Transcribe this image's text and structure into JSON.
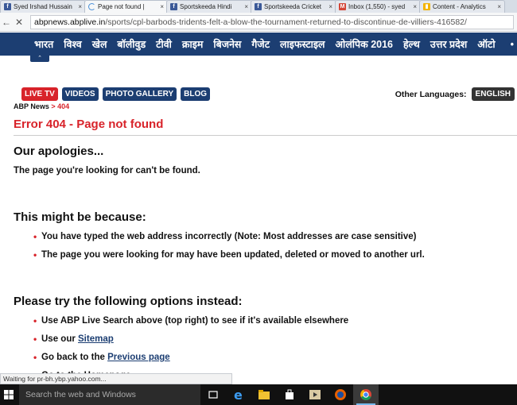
{
  "browser": {
    "tabs": [
      {
        "label": "Syed Irshad Hussain",
        "icon": "facebook-icon",
        "color": "#3b5998"
      },
      {
        "label": "Page not found |",
        "icon": "loading-spinner-icon",
        "color": "#4a90d9"
      },
      {
        "label": "Sportskeeda Hindi",
        "icon": "facebook-icon",
        "color": "#3b5998"
      },
      {
        "label": "Sportskeeda Cricket",
        "icon": "facebook-icon",
        "color": "#3b5998"
      },
      {
        "label": "Inbox (1,550) - syed",
        "icon": "gmail-icon",
        "color": "#d44638"
      },
      {
        "label": "Content - Analytics",
        "icon": "analytics-icon",
        "color": "#f4b400"
      }
    ],
    "url_host": "abpnews.abplive.in",
    "url_path": "/sports/cpl-barbods-tridents-felt-a-blow-the-tournament-returned-to-discontinue-de-villiers-416582/"
  },
  "nav": {
    "items": [
      "भारत",
      "विश्व",
      "खेल",
      "बॉलीवुड",
      "टीवी",
      "क्राइम",
      "बिजनेस",
      "गैजेट",
      "लाइफस्टाइल",
      "ओलंपिक 2016",
      "हेल्थ",
      "उत्तर प्रदेश",
      "ऑटो"
    ],
    "more": "•"
  },
  "buttons": {
    "live": "LIVE TV",
    "videos": "VIDEOS",
    "gallery": "PHOTO GALLERY",
    "blog": "BLOG"
  },
  "languages": {
    "label": "Other Languages:",
    "english": "ENGLISH"
  },
  "breadcrumb": {
    "home": "ABP News",
    "sep": " > ",
    "current": "404"
  },
  "error": {
    "title": "Error 404 - Page not found",
    "apologies": "Our apologies...",
    "message": "The page you're looking for can't be found.",
    "because_heading": "This might be because:",
    "reasons": [
      "You have typed the web address incorrectly (Note: Most addresses are case sensitive)",
      "The page you were looking for may have been updated, deleted or moved to another url."
    ],
    "options_heading": "Please try the following options instead:",
    "option1": "Use ABP Live Search above (top right) to see if it's available elsewhere",
    "option2_prefix": "Use our ",
    "option2_link": "Sitemap",
    "option3_prefix": "Go back to the ",
    "option3_link": "Previous page",
    "option4": "Go to the Homepage"
  },
  "status": "Waiting for pr-bh.ybp.yahoo.com...",
  "taskbar": {
    "search": "Search the web and Windows"
  }
}
